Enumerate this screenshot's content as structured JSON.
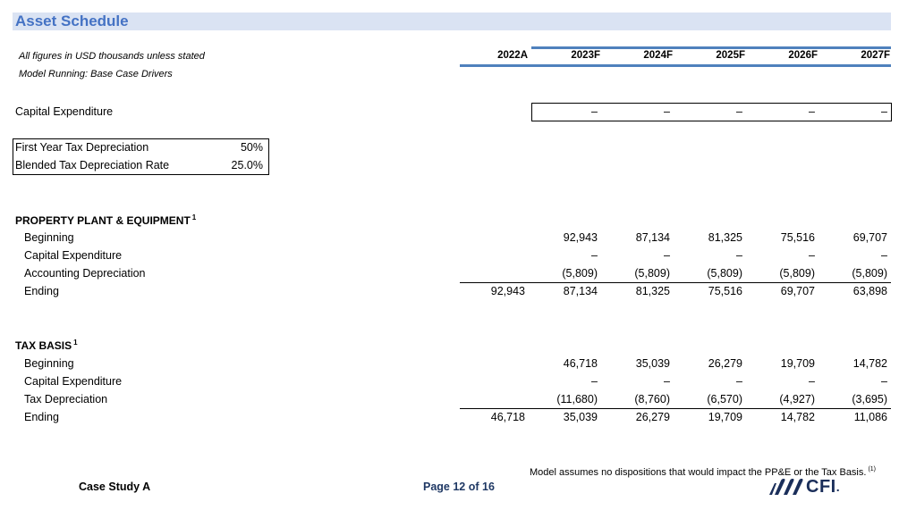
{
  "header": {
    "title": "Asset Schedule",
    "notes": [
      "All figures in USD thousands unless stated",
      "Model Running: Base Case Drivers"
    ]
  },
  "columns": [
    "2022A",
    "2023F",
    "2024F",
    "2025F",
    "2026F",
    "2027F"
  ],
  "capex_input": {
    "label": "Capital Expenditure",
    "values": [
      "",
      "–",
      "–",
      "–",
      "–",
      "–"
    ]
  },
  "tax_rates": [
    {
      "label": "First Year Tax Depreciation",
      "value": "50%"
    },
    {
      "label": "Blended Tax Depreciation Rate",
      "value": "25.0%"
    }
  ],
  "ppe": {
    "title": "PROPERTY PLANT & EQUIPMENT",
    "footnote": "1",
    "rows": [
      {
        "label": "Beginning",
        "values": [
          "",
          "92,943",
          "87,134",
          "81,325",
          "75,516",
          "69,707"
        ]
      },
      {
        "label": "Capital Expenditure",
        "values": [
          "",
          "–",
          "–",
          "–",
          "–",
          "–"
        ]
      },
      {
        "label": "Accounting Depreciation",
        "values": [
          "",
          "(5,809)",
          "(5,809)",
          "(5,809)",
          "(5,809)",
          "(5,809)"
        ]
      },
      {
        "label": "Ending",
        "values": [
          "92,943",
          "87,134",
          "81,325",
          "75,516",
          "69,707",
          "63,898"
        ]
      }
    ]
  },
  "tax_basis": {
    "title": "TAX BASIS",
    "footnote": "1",
    "rows": [
      {
        "label": "Beginning",
        "values": [
          "",
          "46,718",
          "35,039",
          "26,279",
          "19,709",
          "14,782"
        ]
      },
      {
        "label": "Capital Expenditure",
        "values": [
          "",
          "–",
          "–",
          "–",
          "–",
          "–"
        ]
      },
      {
        "label": "Tax Depreciation",
        "values": [
          "",
          "(11,680)",
          "(8,760)",
          "(6,570)",
          "(4,927)",
          "(3,695)"
        ]
      },
      {
        "label": "Ending",
        "values": [
          "46,718",
          "35,039",
          "26,279",
          "19,709",
          "14,782",
          "11,086"
        ]
      }
    ]
  },
  "footer": {
    "disclaimer": "Model assumes no dispositions that would impact the PP&E or the Tax Basis.",
    "disclaimer_mark": "(1)",
    "case_study": "Case Study A",
    "page": "Page 12 of 16",
    "logo_text": "CFI",
    "logo_dot": ".",
    "logo_icon": "cfi-stripes-icon"
  },
  "colors": {
    "title_band": "#dae3f3",
    "title_text": "#4472c4",
    "header_rule": "#4f81bd",
    "page_number": "#1f3864",
    "logo": "#1a2e5a"
  }
}
